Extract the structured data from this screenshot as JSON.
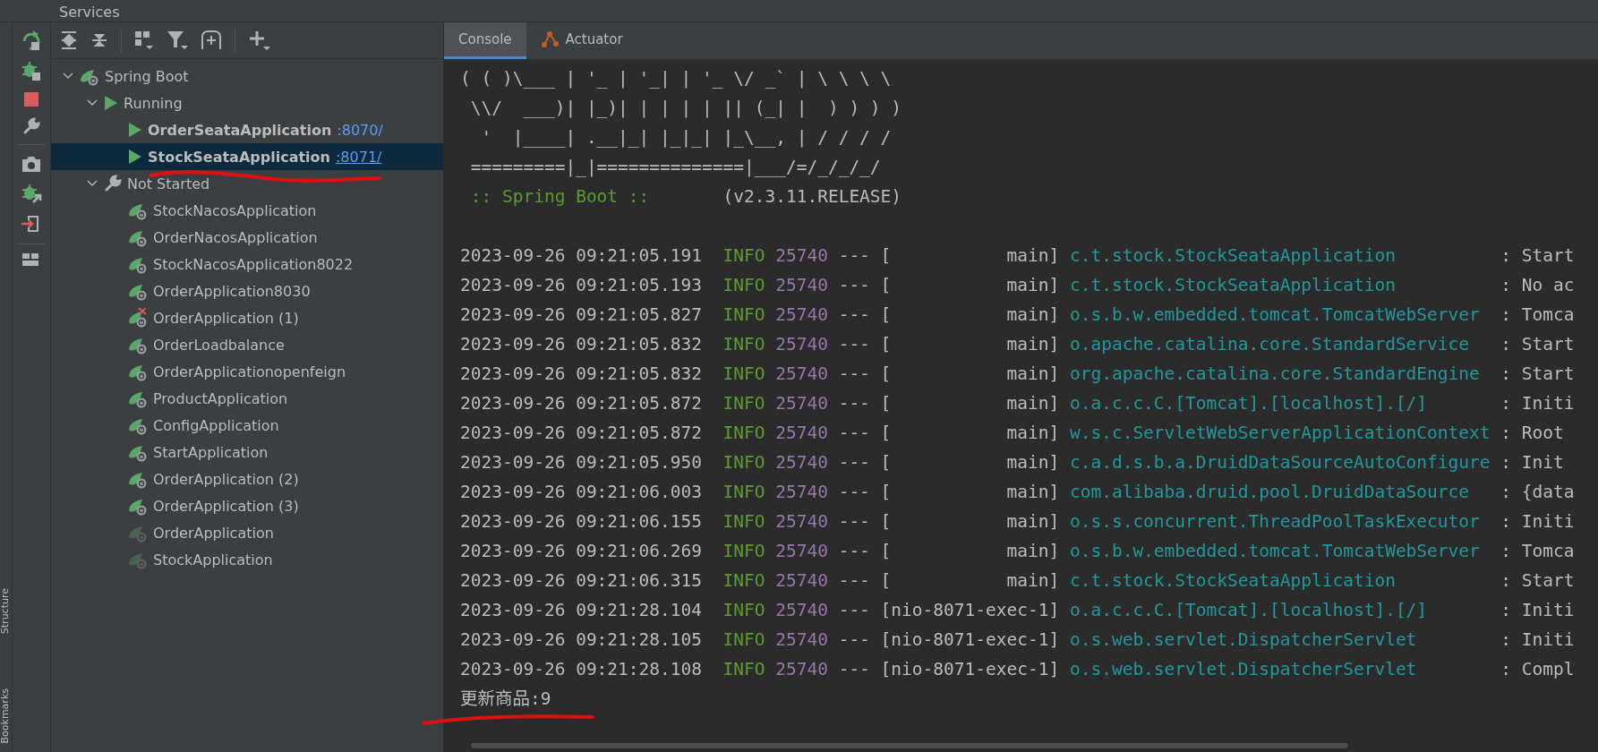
{
  "window": {
    "title": "Services"
  },
  "tree": [
    {
      "label": "Spring Boot",
      "kind": "root",
      "expanded": true,
      "selected": false,
      "children": [
        {
          "label": "Running",
          "kind": "running-group",
          "expanded": true,
          "selected": false,
          "children": [
            {
              "label": "OrderSeataApplication",
              "port": ":8070/",
              "kind": "running",
              "selected": false
            },
            {
              "label": "StockSeataApplication",
              "port": ":8071/",
              "kind": "running",
              "selected": true
            }
          ]
        },
        {
          "label": "Not Started",
          "kind": "stopped-group",
          "expanded": true,
          "selected": false,
          "children": [
            {
              "label": "StockNacosApplication",
              "kind": "app",
              "selected": false
            },
            {
              "label": "OrderNacosApplication",
              "kind": "app",
              "selected": false
            },
            {
              "label": "StockNacosApplication8022",
              "kind": "app",
              "selected": false
            },
            {
              "label": "OrderApplication8030",
              "kind": "app",
              "selected": false
            },
            {
              "label": "OrderApplication (1)",
              "kind": "app-error",
              "selected": false
            },
            {
              "label": "OrderLoadbalance",
              "kind": "app",
              "selected": false
            },
            {
              "label": "OrderApplicationopenfeign",
              "kind": "app",
              "selected": false
            },
            {
              "label": "ProductApplication",
              "kind": "app",
              "selected": false
            },
            {
              "label": "ConfigApplication",
              "kind": "app",
              "selected": false
            },
            {
              "label": "StartApplication",
              "kind": "app",
              "selected": false
            },
            {
              "label": "OrderApplication (2)",
              "kind": "app",
              "selected": false
            },
            {
              "label": "OrderApplication (3)",
              "kind": "app",
              "selected": false
            },
            {
              "label": "OrderApplication",
              "kind": "app-inactive",
              "selected": false
            },
            {
              "label": "StockApplication",
              "kind": "app-inactive",
              "selected": false
            }
          ]
        }
      ]
    }
  ],
  "side_labels": [
    "Structure",
    "Bookmarks"
  ],
  "console": {
    "tabs": [
      {
        "label": "Console",
        "kind": "text",
        "selected": true
      },
      {
        "label": "Actuator",
        "kind": "actuator",
        "selected": false
      }
    ],
    "banner": [
      "( ( )\\___ | '_ | '_| | '_ \\/ _` | \\ \\ \\ \\",
      " \\\\/  ___)| |_)| | | | | || (_| |  ) ) ) )",
      "  '  |____| .__|_| |_|_| |_\\__, | / / / /",
      " =========|_|==============|___/=/_/_/_/"
    ],
    "banner_footer": {
      "label": " :: Spring Boot ::",
      "version": "(v2.3.11.RELEASE)"
    },
    "logs": [
      {
        "time": "2023-09-26 09:21:05.191",
        "level": "INFO",
        "pid": "25740",
        "sep": "---",
        "thread": "[           main]",
        "logger": "c.t.stock.StockSeataApplication",
        "message": ": Start"
      },
      {
        "time": "2023-09-26 09:21:05.193",
        "level": "INFO",
        "pid": "25740",
        "sep": "---",
        "thread": "[           main]",
        "logger": "c.t.stock.StockSeataApplication",
        "message": ": No ac"
      },
      {
        "time": "2023-09-26 09:21:05.827",
        "level": "INFO",
        "pid": "25740",
        "sep": "---",
        "thread": "[           main]",
        "logger": "o.s.b.w.embedded.tomcat.TomcatWebServer",
        "message": ": Tomca"
      },
      {
        "time": "2023-09-26 09:21:05.832",
        "level": "INFO",
        "pid": "25740",
        "sep": "---",
        "thread": "[           main]",
        "logger": "o.apache.catalina.core.StandardService",
        "message": ": Start"
      },
      {
        "time": "2023-09-26 09:21:05.832",
        "level": "INFO",
        "pid": "25740",
        "sep": "---",
        "thread": "[           main]",
        "logger": "org.apache.catalina.core.StandardEngine",
        "message": ": Start"
      },
      {
        "time": "2023-09-26 09:21:05.872",
        "level": "INFO",
        "pid": "25740",
        "sep": "---",
        "thread": "[           main]",
        "logger": "o.a.c.c.C.[Tomcat].[localhost].[/]",
        "message": ": Initi"
      },
      {
        "time": "2023-09-26 09:21:05.872",
        "level": "INFO",
        "pid": "25740",
        "sep": "---",
        "thread": "[           main]",
        "logger": "w.s.c.ServletWebServerApplicationContext",
        "message": ": Root"
      },
      {
        "time": "2023-09-26 09:21:05.950",
        "level": "INFO",
        "pid": "25740",
        "sep": "---",
        "thread": "[           main]",
        "logger": "c.a.d.s.b.a.DruidDataSourceAutoConfigure",
        "message": ": Init"
      },
      {
        "time": "2023-09-26 09:21:06.003",
        "level": "INFO",
        "pid": "25740",
        "sep": "---",
        "thread": "[           main]",
        "logger": "com.alibaba.druid.pool.DruidDataSource",
        "message": ": {data"
      },
      {
        "time": "2023-09-26 09:21:06.155",
        "level": "INFO",
        "pid": "25740",
        "sep": "---",
        "thread": "[           main]",
        "logger": "o.s.s.concurrent.ThreadPoolTaskExecutor",
        "message": ": Initi"
      },
      {
        "time": "2023-09-26 09:21:06.269",
        "level": "INFO",
        "pid": "25740",
        "sep": "---",
        "thread": "[           main]",
        "logger": "o.s.b.w.embedded.tomcat.TomcatWebServer",
        "message": ": Tomca"
      },
      {
        "time": "2023-09-26 09:21:06.315",
        "level": "INFO",
        "pid": "25740",
        "sep": "---",
        "thread": "[           main]",
        "logger": "c.t.stock.StockSeataApplication",
        "message": ": Start"
      },
      {
        "time": "2023-09-26 09:21:28.104",
        "level": "INFO",
        "pid": "25740",
        "sep": "---",
        "thread": "[nio-8071-exec-1]",
        "logger": "o.a.c.c.C.[Tomcat].[localhost].[/]",
        "message": ": Initi"
      },
      {
        "time": "2023-09-26 09:21:28.105",
        "level": "INFO",
        "pid": "25740",
        "sep": "---",
        "thread": "[nio-8071-exec-1]",
        "logger": "o.s.web.servlet.DispatcherServlet",
        "message": ": Initi"
      },
      {
        "time": "2023-09-26 09:21:28.108",
        "level": "INFO",
        "pid": "25740",
        "sep": "---",
        "thread": "[nio-8071-exec-1]",
        "logger": "o.s.web.servlet.DispatcherServlet",
        "message": ": Compl"
      }
    ],
    "output": "更新商品:9"
  }
}
